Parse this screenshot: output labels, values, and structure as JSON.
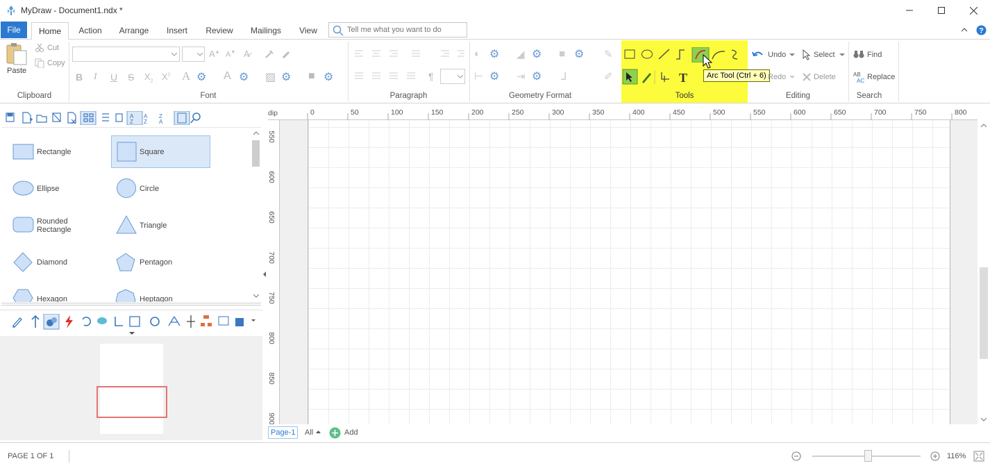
{
  "window": {
    "title": "MyDraw - Document1.ndx *"
  },
  "tabs": [
    "File",
    "Home",
    "Action",
    "Arrange",
    "Insert",
    "Review",
    "Mailings",
    "View"
  ],
  "tell_me": {
    "placeholder": "Tell me what you want to do"
  },
  "clipboard": {
    "paste": "Paste",
    "cut": "Cut",
    "copy": "Copy",
    "label": "Clipboard"
  },
  "groups": {
    "font": "Font",
    "paragraph": "Paragraph",
    "geometry": "Geometry Format",
    "tools": "Tools",
    "editing": "Editing",
    "search": "Search"
  },
  "editing": {
    "undo": "Undo",
    "redo": "Redo",
    "select": "Select",
    "delete": "Delete"
  },
  "search": {
    "find": "Find",
    "replace": "Replace"
  },
  "tooltip": "Arc Tool (Ctrl + 6)",
  "shapes": [
    {
      "left": "Rectangle",
      "right": "Square"
    },
    {
      "left": "Ellipse",
      "right": "Circle"
    },
    {
      "left": "Rounded Rectangle",
      "right": "Triangle"
    },
    {
      "left": "Diamond",
      "right": "Pentagon"
    },
    {
      "left": "Hexagon",
      "right": "Heptagon"
    }
  ],
  "ruler": {
    "unit": "dip",
    "top": [
      "0",
      "50",
      "100",
      "150",
      "200",
      "250",
      "300",
      "350",
      "400",
      "450",
      "500",
      "550",
      "600",
      "650",
      "700",
      "750",
      "800"
    ],
    "left": [
      "550",
      "600",
      "650",
      "700",
      "750",
      "800",
      "850",
      "900"
    ]
  },
  "pages": {
    "current": "Page-1",
    "all": "All",
    "add": "Add"
  },
  "status": {
    "page": "PAGE 1 OF 1",
    "zoom": "116%"
  },
  "colors": {
    "accent": "#2b79d0",
    "tools_highlight": "#fcfc3c",
    "shape_fill": "#cfe1f8",
    "shape_stroke": "#6a9ad4",
    "nav_frame": "#e57373"
  }
}
